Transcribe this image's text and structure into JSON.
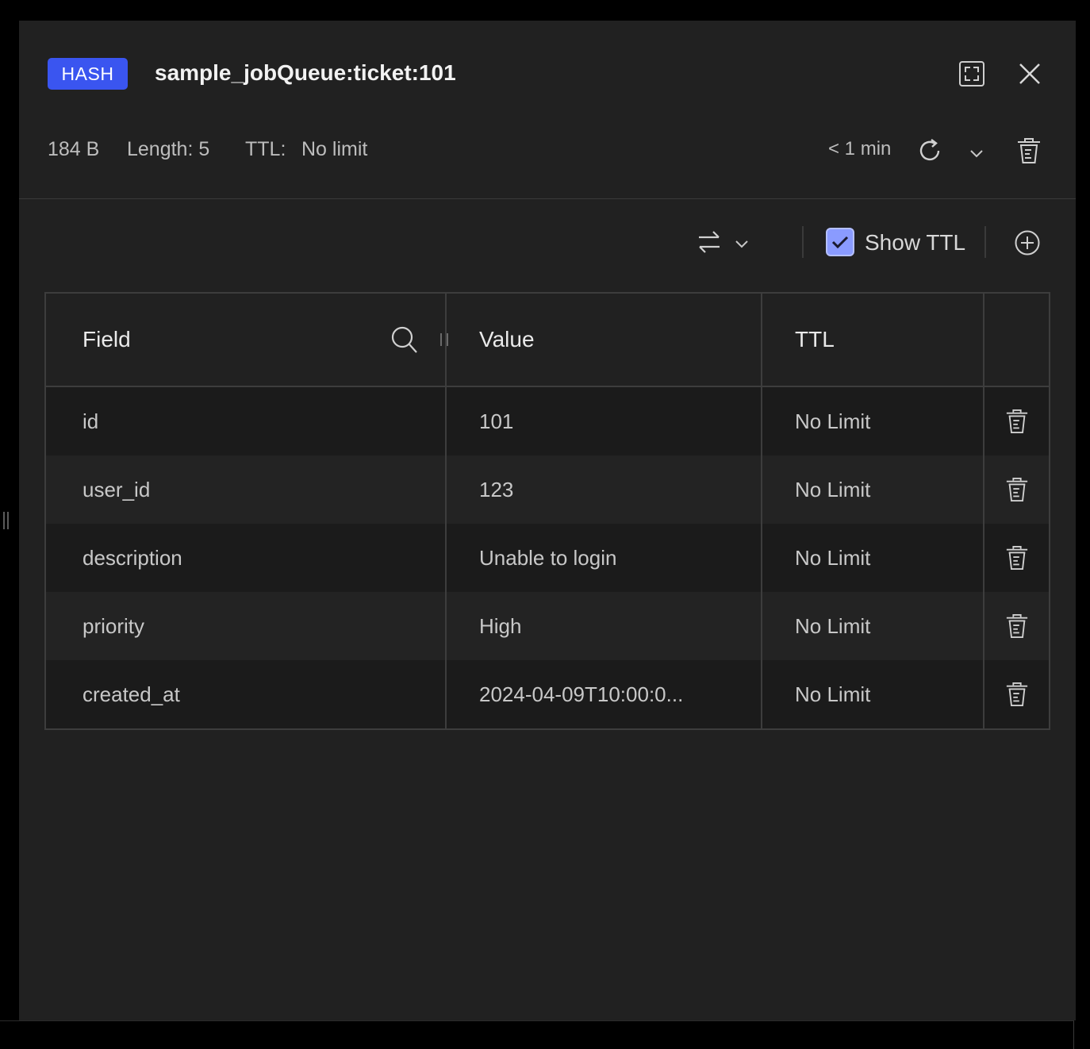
{
  "header": {
    "type_badge": "HASH",
    "key_name": "sample_jobQueue:ticket:101"
  },
  "meta": {
    "size": "184 B",
    "length": "Length: 5",
    "ttl_label": "TTL:",
    "ttl_value": "No limit",
    "refresh_age": "< 1 min"
  },
  "toolbar": {
    "show_ttl_label": "Show TTL",
    "show_ttl_checked": true
  },
  "table": {
    "columns": [
      "Field",
      "Value",
      "TTL",
      ""
    ],
    "rows": [
      {
        "field": "id",
        "value": "101",
        "ttl": "No Limit"
      },
      {
        "field": "user_id",
        "value": "123",
        "ttl": "No Limit"
      },
      {
        "field": "description",
        "value": "Unable to login",
        "ttl": "No Limit"
      },
      {
        "field": "priority",
        "value": "High",
        "ttl": "No Limit"
      },
      {
        "field": "created_at",
        "value": "2024-04-09T10:00:0...",
        "ttl": "No Limit"
      }
    ]
  },
  "colors": {
    "accent": "#3a55f0",
    "checkbox": "#8a9bff",
    "panel_bg": "#212121"
  },
  "icons": [
    "fullscreen-icon",
    "close-icon",
    "refresh-icon",
    "chevron-down-icon",
    "trash-icon",
    "swap-icon",
    "plus-circle-icon",
    "search-icon",
    "check-icon"
  ]
}
